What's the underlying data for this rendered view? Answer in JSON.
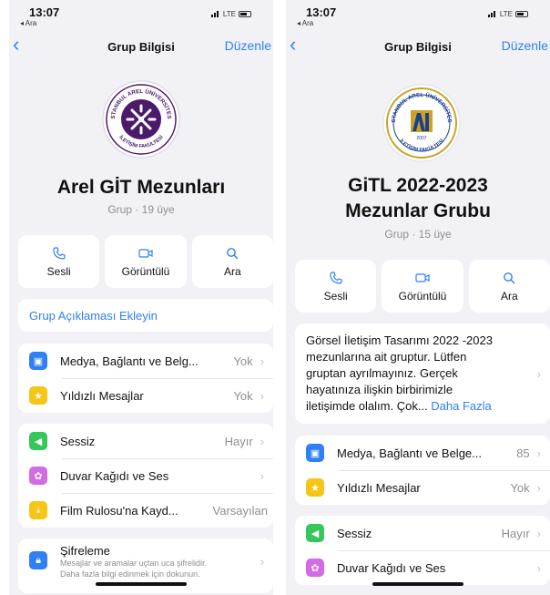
{
  "screens": [
    {
      "status": {
        "time": "13:07",
        "back_app": "◂ Ara",
        "network": "LTE"
      },
      "nav": {
        "back": "‹",
        "title": "Grup Bilgisi",
        "edit": "Düzenle"
      },
      "logo": {
        "top_text": "İSTANBUL AREL ÜNİVERSİTESİ",
        "bottom_text": "İLETİŞİM FAKÜLTESİ",
        "colors": {
          "ring": "#4b1a6b",
          "accent": "#ffffff"
        }
      },
      "group_name": "Arel GİT Mezunları",
      "group_sub": "Grup · 19 üye",
      "actions": [
        {
          "icon": "phone-icon",
          "label": "Sesli"
        },
        {
          "icon": "video-icon",
          "label": "Görüntülü"
        },
        {
          "icon": "search-icon",
          "label": "Ara"
        }
      ],
      "add_description": "Grup Açıklaması Ekleyin",
      "section1": [
        {
          "icon": "photo-icon",
          "color": "#2f7ff6",
          "label": "Medya, Bağlantı ve Belg...",
          "value": "Yok"
        },
        {
          "icon": "star-icon",
          "color": "#f5c518",
          "label": "Yıldızlı Mesajlar",
          "value": "Yok"
        }
      ],
      "section2": [
        {
          "icon": "speaker-icon",
          "color": "#34c759",
          "label": "Sessiz",
          "value": "Hayır"
        },
        {
          "icon": "flower-icon",
          "color": "#d36ae6",
          "label": "Duvar Kağıdı ve Ses",
          "value": ""
        },
        {
          "icon": "save-icon",
          "color": "#f5c518",
          "label": "Film Rulosu'na Kayd...",
          "value": "Varsayılan"
        }
      ],
      "encryption": {
        "label": "Şifreleme",
        "line1": "Mesajlar ve aramalar uçtan uca şifrelidir.",
        "line2": "Daha fazla bilgi edinmek için dokunun."
      }
    },
    {
      "status": {
        "time": "13:07",
        "back_app": "◂ Ara",
        "network": "LTE"
      },
      "nav": {
        "back": "‹",
        "title": "Grup Bilgisi",
        "edit": "Düzenle"
      },
      "logo": {
        "top_text": "İSTANBUL AREL ÜNİVERSİTESİ",
        "bottom_text": "İLETİŞİM FAKÜLTESİ",
        "year": "2007",
        "colors": {
          "ring": "#c9a227",
          "accent": "#1c3f8c"
        }
      },
      "group_name_line1": "GiTL 2022-2023",
      "group_name_line2": "Mezunlar Grubu",
      "group_sub": "Grup · 15 üye",
      "actions": [
        {
          "icon": "phone-icon",
          "label": "Sesli"
        },
        {
          "icon": "video-icon",
          "label": "Görüntülü"
        },
        {
          "icon": "search-icon",
          "label": "Ara"
        }
      ],
      "description": {
        "lines": [
          "Görsel İletişim Tasarımı 2022 -2023",
          "mezunlarına ait gruptur. Lütfen",
          "gruptan ayrılmayınız. Gerçek",
          "hayatınıza ilişkin birbirimizle",
          "iletişimde olalım. Çok..."
        ],
        "more": "Daha Fazla"
      },
      "section1": [
        {
          "icon": "photo-icon",
          "color": "#2f7ff6",
          "label": "Medya, Bağlantı ve Belge...",
          "value": "85"
        },
        {
          "icon": "star-icon",
          "color": "#f5c518",
          "label": "Yıldızlı Mesajlar",
          "value": "Yok"
        }
      ],
      "section2": [
        {
          "icon": "speaker-icon",
          "color": "#34c759",
          "label": "Sessiz",
          "value": "Hayır"
        },
        {
          "icon": "flower-icon",
          "color": "#d36ae6",
          "label": "Duvar Kağıdı ve Ses",
          "value": ""
        }
      ]
    }
  ]
}
